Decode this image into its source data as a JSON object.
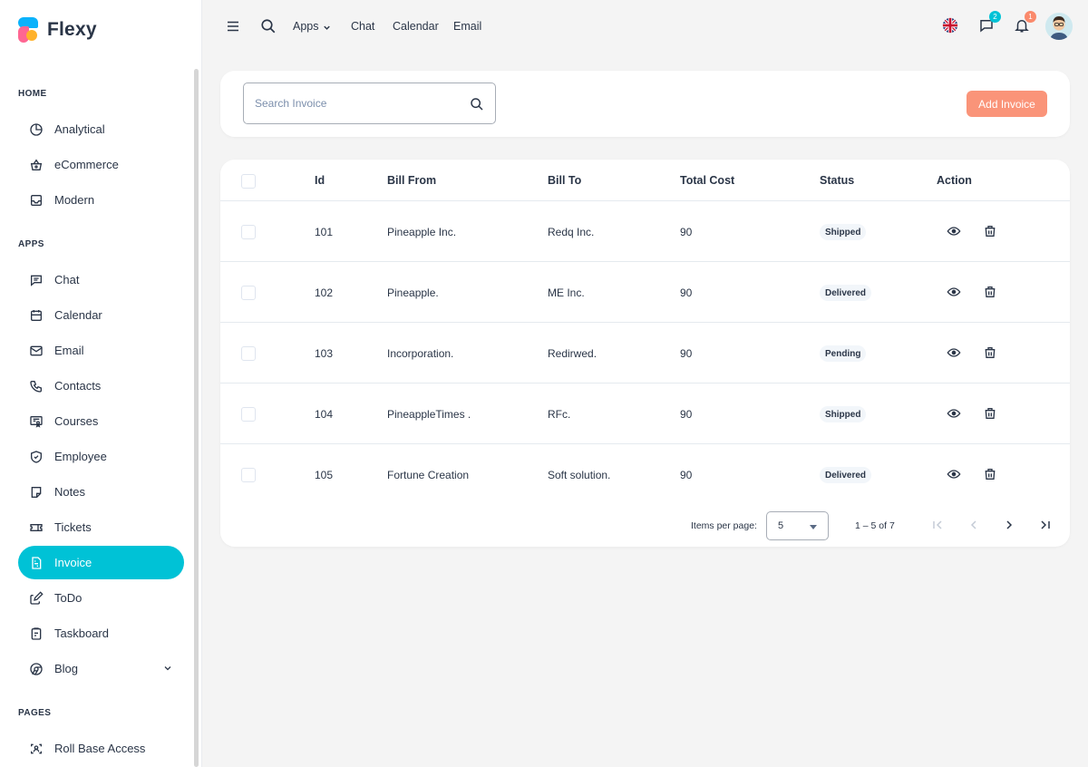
{
  "brand": {
    "name": "Flexy"
  },
  "sidebar": {
    "sections": [
      {
        "title": "HOME"
      },
      {
        "title": "APPS"
      },
      {
        "title": "PAGES"
      }
    ],
    "items": [
      {
        "label": "Analytical",
        "icon": "pie-chart-icon"
      },
      {
        "label": "eCommerce",
        "icon": "basket-icon"
      },
      {
        "label": "Modern",
        "icon": "inbox-icon"
      },
      {
        "label": "Chat",
        "icon": "message-icon"
      },
      {
        "label": "Calendar",
        "icon": "calendar-icon"
      },
      {
        "label": "Email",
        "icon": "mail-icon"
      },
      {
        "label": "Contacts",
        "icon": "phone-icon"
      },
      {
        "label": "Courses",
        "icon": "certificate-icon"
      },
      {
        "label": "Employee",
        "icon": "shield-icon"
      },
      {
        "label": "Notes",
        "icon": "note-icon"
      },
      {
        "label": "Tickets",
        "icon": "ticket-icon"
      },
      {
        "label": "Invoice",
        "icon": "file-invoice-icon",
        "active": true
      },
      {
        "label": "ToDo",
        "icon": "edit-icon"
      },
      {
        "label": "Taskboard",
        "icon": "clipboard-icon"
      },
      {
        "label": "Blog",
        "icon": "chrome-icon"
      },
      {
        "label": "Roll Base Access",
        "icon": "user-scan-icon"
      }
    ]
  },
  "topbar": {
    "links": [
      "Apps",
      "Chat",
      "Calendar",
      "Email"
    ],
    "chat_badge": "2",
    "notif_badge": "1"
  },
  "search": {
    "placeholder": "Search Invoice"
  },
  "add_button": "Add Invoice",
  "table": {
    "headers": {
      "id": "Id",
      "bill_from": "Bill From",
      "bill_to": "Bill To",
      "total": "Total Cost",
      "status": "Status",
      "action": "Action"
    },
    "rows": [
      {
        "id": "101",
        "bill_from": "Pineapple Inc.",
        "bill_to": "Redq Inc.",
        "total": "90",
        "status": "Shipped"
      },
      {
        "id": "102",
        "bill_from": "Pineapple.",
        "bill_to": "ME Inc.",
        "total": "90",
        "status": "Delivered"
      },
      {
        "id": "103",
        "bill_from": "Incorporation.",
        "bill_to": "Redirwed.",
        "total": "90",
        "status": "Pending"
      },
      {
        "id": "104",
        "bill_from": "PineappleTimes .",
        "bill_to": "RFc.",
        "total": "90",
        "status": "Shipped"
      },
      {
        "id": "105",
        "bill_from": "Fortune Creation",
        "bill_to": "Soft solution.",
        "total": "90",
        "status": "Delivered"
      }
    ]
  },
  "pagination": {
    "label": "Items per page:",
    "per_page": "5",
    "range": "1 – 5 of 7"
  },
  "colors": {
    "accent": "#00c2d6",
    "add_button": "#fa896b",
    "chat_badge": "#00c2d6",
    "notif_badge": "#fa896b"
  }
}
